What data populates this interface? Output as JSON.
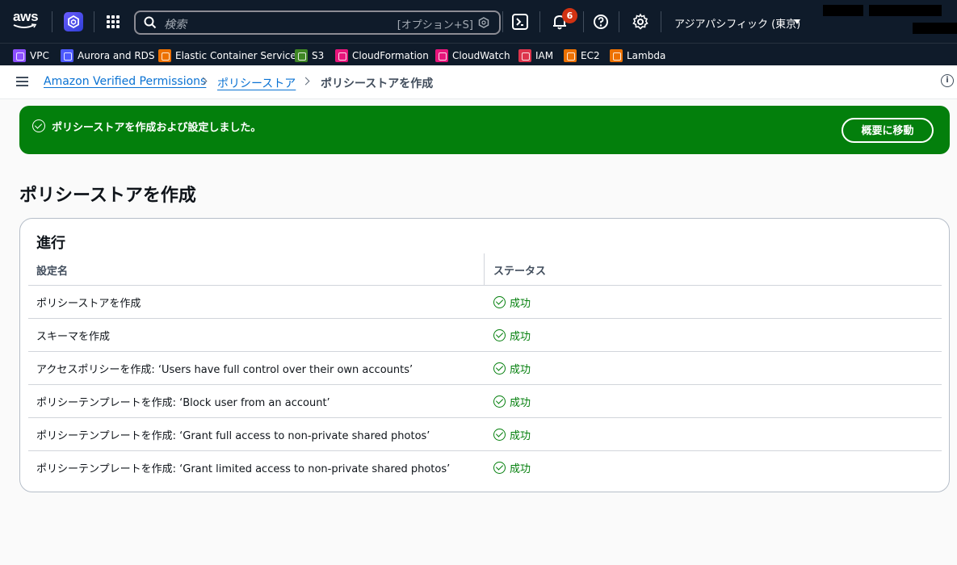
{
  "nav": {
    "logo": "aws",
    "search_placeholder": "検索",
    "search_shortcut": "[オプション+S]",
    "notifications_count": "6",
    "region": "アジアパシフィック (東京)",
    "icons": [
      "q-icon",
      "apps-grid-icon",
      "search-icon",
      "cloudshell-icon",
      "bell-icon",
      "help-icon",
      "gear-icon"
    ]
  },
  "favorites": [
    {
      "label": "VPC",
      "color": "#8c4fff"
    },
    {
      "label": "Aurora and RDS",
      "color": "#4d59ff"
    },
    {
      "label": "Elastic Container Service",
      "color": "#ed7100"
    },
    {
      "label": "S3",
      "color": "#3f8624"
    },
    {
      "label": "CloudFormation",
      "color": "#e7157b"
    },
    {
      "label": "CloudWatch",
      "color": "#e7157b"
    },
    {
      "label": "IAM",
      "color": "#dd344c"
    },
    {
      "label": "EC2",
      "color": "#ed7100"
    },
    {
      "label": "Lambda",
      "color": "#ed7100"
    }
  ],
  "breadcrumb": {
    "items": [
      "Amazon Verified Permissions",
      "ポリシーストア",
      "ポリシーストアを作成"
    ]
  },
  "flash": {
    "message": "ポリシーストアを作成および設定しました。",
    "button": "概要に移動",
    "color": "#037f0c"
  },
  "page": {
    "title": "ポリシーストアを作成"
  },
  "progress": {
    "heading": "進行",
    "columns": [
      "設定名",
      "ステータス"
    ],
    "rows": [
      {
        "name": "ポリシーストアを作成",
        "status": "成功"
      },
      {
        "name": "スキーマを作成",
        "status": "成功"
      },
      {
        "name": "アクセスポリシーを作成: ‘Users have full control over their own accounts’",
        "status": "成功"
      },
      {
        "name": "ポリシーテンプレートを作成: ‘Block user from an account’",
        "status": "成功"
      },
      {
        "name": "ポリシーテンプレートを作成: ‘Grant full access to non-private shared photos’",
        "status": "成功"
      },
      {
        "name": "ポリシーテンプレートを作成: ‘Grant limited access to non-private shared photos’",
        "status": "成功"
      }
    ]
  }
}
